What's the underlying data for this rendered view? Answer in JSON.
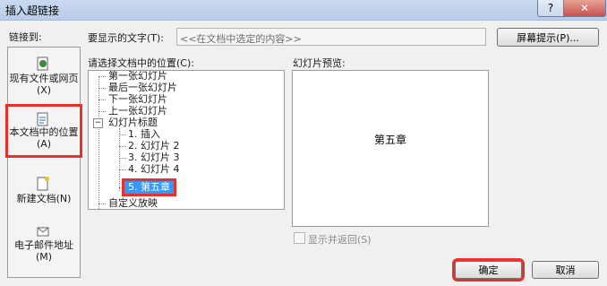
{
  "window": {
    "title": "插入超链接",
    "help_label": "?",
    "close_label": "✕"
  },
  "link_to": {
    "label": "链接到:",
    "items": [
      {
        "label": "现有文件或网页(X)",
        "icon": "web-file-icon"
      },
      {
        "label": "本文档中的位置(A)",
        "icon": "document-place-icon",
        "selected": true
      },
      {
        "label": "新建文档(N)",
        "icon": "new-document-icon"
      },
      {
        "label": "电子邮件地址(M)",
        "icon": "email-icon"
      }
    ]
  },
  "display_text": {
    "label": "要显示的文字(T):",
    "value": "<<在文档中选定的内容>>",
    "screentip_button": "屏幕提示(P)..."
  },
  "location": {
    "label": "请选择文档中的位置(C):",
    "tree": [
      "第一张幻灯片",
      "最后一张幻灯片",
      "下一张幻灯片",
      "上一张幻灯片",
      "幻灯片标题",
      "1. 插入",
      "2. 幻灯片 2",
      "3. 幻灯片 3",
      "4. 幻灯片 4",
      "5. 第五章",
      "自定义放映"
    ],
    "selected": "5. 第五章"
  },
  "preview": {
    "label": "幻灯片预览:",
    "slide_title": "第五章",
    "show_and_return_label": "显示并返回(S)",
    "show_and_return_checked": false
  },
  "buttons": {
    "ok": "确定",
    "cancel": "取消"
  },
  "colors": {
    "highlight": "#e8312b",
    "selection": "#3399ff"
  }
}
